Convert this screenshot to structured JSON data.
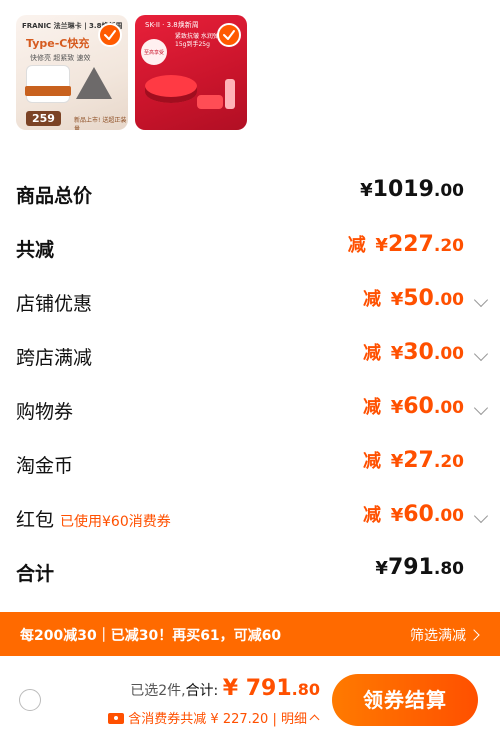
{
  "products": [
    {
      "brand": "FRANIC 法兰琳卡 | 3.8焕新周",
      "title": "Type-C快充",
      "subtitle": "快修亮 超紧致 速效",
      "price": "259",
      "tag": "新品上市! 送超正装量",
      "selected": true
    },
    {
      "brand": "SK-II · 3.8焕新周",
      "text": "紧致抗皱 水润弹 至高买15g到手25g",
      "badge": "至高享受",
      "selected": true
    }
  ],
  "summary": {
    "total_label": "商品总价",
    "total_yen": "¥",
    "total_int": "1019",
    "total_dec": ".00",
    "discount_label": "共减",
    "discount_prefix": "减",
    "discount_yen": "¥",
    "discount_int": "227",
    "discount_dec": ".20",
    "rows": [
      {
        "label": "店铺优惠",
        "prefix": "减",
        "yen": "¥",
        "int": "50",
        "dec": ".00",
        "chevron": true
      },
      {
        "label": "跨店满减",
        "prefix": "减",
        "yen": "¥",
        "int": "30",
        "dec": ".00",
        "chevron": true
      },
      {
        "label": "购物券",
        "prefix": "减",
        "yen": "¥",
        "int": "60",
        "dec": ".00",
        "chevron": true
      },
      {
        "label": "淘金币",
        "prefix": "减",
        "yen": "¥",
        "int": "27",
        "dec": ".20",
        "chevron": false
      },
      {
        "label": "红包",
        "note": "已使用¥60消费券",
        "prefix": "减",
        "yen": "¥",
        "int": "60",
        "dec": ".00",
        "chevron": true
      }
    ],
    "sum_label": "合计",
    "sum_yen": "¥",
    "sum_int": "791",
    "sum_dec": ".80"
  },
  "promo": {
    "text": "每200减30｜已减30！再买61，可减60",
    "filter": "筛选满减"
  },
  "bottom": {
    "selected_text": "已选2件,",
    "total_label": "合计:",
    "total_yen": "¥",
    "total_int": "791",
    "total_dec": ".80",
    "coupon_text": "含消费券共减 ¥ 227.20",
    "separator": "|",
    "detail": "明细",
    "checkout": "领券结算"
  },
  "colors": {
    "accent": "#ff5000",
    "promo_bg": "#ff6a00"
  }
}
